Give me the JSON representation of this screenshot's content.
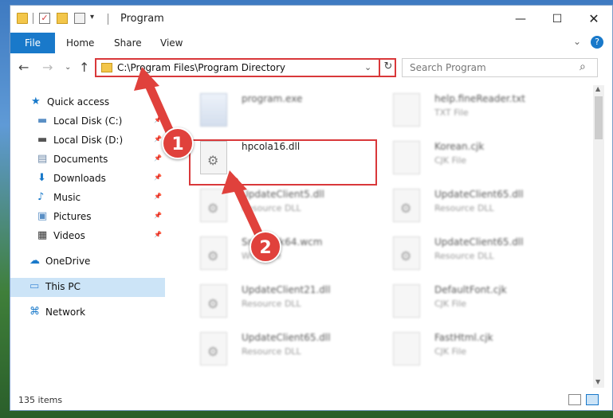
{
  "window": {
    "title": "Program",
    "controls": {
      "minimize": "—",
      "maximize": "☐",
      "close": "✕"
    },
    "quick_access_dropdown": "▾"
  },
  "ribbon": {
    "tabs": [
      "File",
      "Home",
      "Share",
      "View"
    ],
    "chevron": "⌄",
    "help": "?"
  },
  "navigation": {
    "back": "←",
    "forward": "→",
    "recent": "⌄",
    "up": "↑",
    "address": "C:\\Program Files\\Program Directory",
    "address_dropdown": "⌄",
    "refresh": "↻",
    "search_placeholder": "Search Program",
    "search_icon": "⌕"
  },
  "sidebar": {
    "pin_glyph": "📌",
    "items": [
      {
        "label": "Quick access",
        "icon": "star-icon",
        "color": "#1979ca"
      },
      {
        "label": "Local Disk (C:)",
        "icon": "drive-icon",
        "color": "#5a8fc5"
      },
      {
        "label": "Local Disk (D:)",
        "icon": "drive-icon",
        "color": "#555555"
      },
      {
        "label": "Documents",
        "icon": "document-icon",
        "color": "#6d88a8"
      },
      {
        "label": "Downloads",
        "icon": "download-icon",
        "color": "#1979ca"
      },
      {
        "label": "Music",
        "icon": "music-icon",
        "color": "#1979ca"
      },
      {
        "label": "Pictures",
        "icon": "pictures-icon",
        "color": "#5a8fc5"
      },
      {
        "label": "Videos",
        "icon": "videos-icon",
        "color": "#333333"
      },
      {
        "label": "OneDrive",
        "icon": "cloud-icon",
        "color": "#1979ca"
      },
      {
        "label": "This PC",
        "icon": "computer-icon",
        "color": "#4a90d9"
      },
      {
        "label": "Network",
        "icon": "network-icon",
        "color": "#1979ca"
      }
    ]
  },
  "files": [
    {
      "name": "program.exe",
      "type": "",
      "kind": "exe"
    },
    {
      "name": "help.fineReader.txt",
      "type": "TXT File",
      "kind": "txt"
    },
    {
      "name": "hpcola16.dll",
      "type": "",
      "kind": "dll"
    },
    {
      "name": "Korean.cjk",
      "type": "CJK File",
      "kind": "txt"
    },
    {
      "name": "UpdateClient5.dll",
      "type": "Resource DLL",
      "kind": "dll"
    },
    {
      "name": "UpdateClient65.dll",
      "type": "Resource DLL",
      "kind": "dll"
    },
    {
      "name": "SndTrack64.wcm",
      "type": "WCM File",
      "kind": "dll"
    },
    {
      "name": "UpdateClient65.dll",
      "type": "Resource DLL",
      "kind": "dll"
    },
    {
      "name": "UpdateClient21.dll",
      "type": "Resource DLL",
      "kind": "dll"
    },
    {
      "name": "DefaultFont.cjk",
      "type": "CJK File",
      "kind": "txt"
    },
    {
      "name": "UpdateClient65.dll",
      "type": "Resource DLL",
      "kind": "dll"
    },
    {
      "name": "FastHtml.cjk",
      "type": "CJK File",
      "kind": "txt"
    }
  ],
  "status": {
    "item_count": "135 items"
  },
  "annotations": {
    "step1": "1",
    "step2": "2",
    "color": "#e0413c"
  }
}
